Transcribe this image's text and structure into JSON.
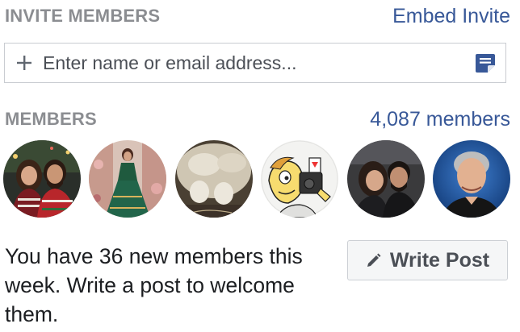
{
  "invite": {
    "heading": "INVITE MEMBERS",
    "embed_link": "Embed Invite",
    "input_placeholder": "Enter name or email address...",
    "input_value": ""
  },
  "members": {
    "heading": "MEMBERS",
    "count_link": "4,087 members",
    "avatars": [
      {
        "name": "avatar-couple-christmas"
      },
      {
        "name": "avatar-woman-green-dress"
      },
      {
        "name": "avatar-cat-paws"
      },
      {
        "name": "avatar-cartoon-camera"
      },
      {
        "name": "avatar-couple-selfie"
      },
      {
        "name": "avatar-man-portrait"
      }
    ]
  },
  "welcome": {
    "message": "You have 36 new members this week. Write a post to welcome them.",
    "button_label": "Write Post"
  },
  "colors": {
    "link": "#385898",
    "heading": "#8b8d91",
    "note_icon": "#385898"
  },
  "icons": [
    "plus-icon",
    "note-icon",
    "pencil-icon"
  ]
}
